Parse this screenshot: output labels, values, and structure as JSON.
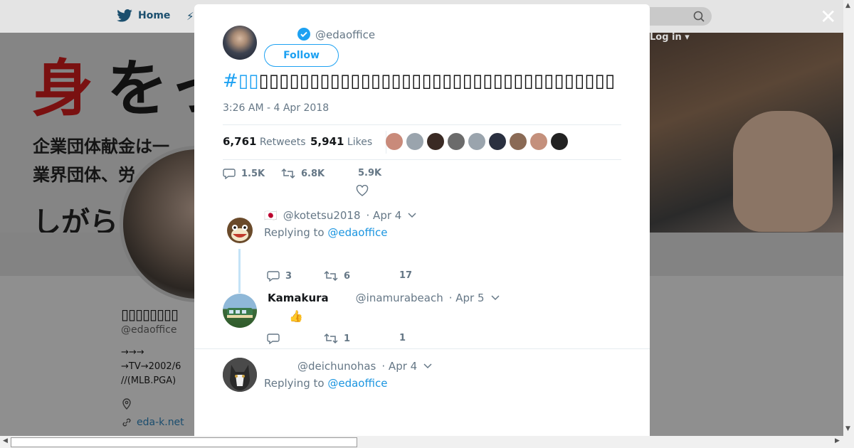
{
  "nav": {
    "home_label": "Home",
    "login_label": "Log in ▾"
  },
  "banner": {
    "kanji_red": "身",
    "kanji_black": "をっ",
    "line1": "企業団体献金は一",
    "line2": "業界団体、労",
    "line3": "しがら"
  },
  "profile": {
    "name": "▯▯▯▯▯▯▯▯",
    "handle": "@edaoffice",
    "bio_line1": "→→→",
    "bio_line2": "→TV→2002/6",
    "bio_line3": "//(MLB.PGA)",
    "link": "eda-k.net"
  },
  "tweet": {
    "handle": "@edaoffice",
    "follow_label": "Follow",
    "hashtag": "#▯▯",
    "text": "▯▯▯▯▯▯▯▯▯▯▯▯▯▯▯▯▯▯▯▯▯▯▯▯▯▯▯▯▯▯▯▯▯▯▯",
    "time": "3:26 AM - 4 Apr 2018",
    "retweets_count": "6,761",
    "retweets_label": "Retweets",
    "likes_count": "5,941",
    "likes_label": "Likes",
    "reply_count": "1.5K",
    "retweet_count": "6.8K",
    "like_count": "5.9K"
  },
  "replies": [
    {
      "flag": "🇯🇵",
      "name": "",
      "handle": "@kotetsu2018",
      "date": "· Apr 4",
      "replying_prefix": "Replying to",
      "replying_to": "@edaoffice",
      "text": "",
      "replies": "3",
      "retweets": "6",
      "likes": "17"
    },
    {
      "name": "Kamakura",
      "handle": "@inamurabeach",
      "date": "· Apr 5",
      "text": "👍",
      "replies": "",
      "retweets": "1",
      "likes": "1"
    },
    {
      "name": "",
      "handle": "@deichunohas",
      "date": "· Apr 4",
      "replying_prefix": "Replying to",
      "replying_to": "@edaoffice"
    }
  ],
  "colors": {
    "accent": "#1da1f2",
    "link": "#1b95e0",
    "muted": "#657786"
  }
}
